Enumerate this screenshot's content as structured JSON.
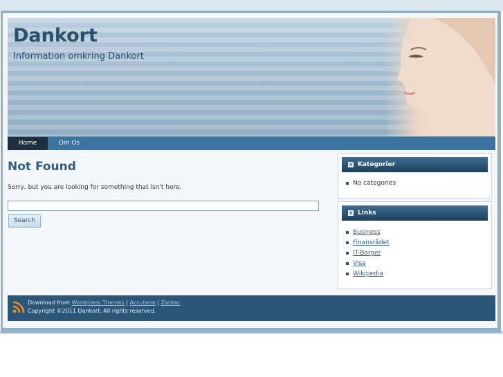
{
  "header": {
    "title": "Dankort",
    "description": "Information omkring Dankort"
  },
  "nav": {
    "items": [
      {
        "label": "Home",
        "active": true
      },
      {
        "label": "Om Os",
        "active": false
      }
    ]
  },
  "main": {
    "title": "Not Found",
    "message": "Sorry, but you are looking for something that isn't here.",
    "search": {
      "value": "",
      "button_label": "Search"
    }
  },
  "sidebar": {
    "categories": {
      "title": "Kategorier",
      "items": [
        "No categories"
      ]
    },
    "links": {
      "title": "Links",
      "items": [
        "Business",
        "Finansrådet",
        "IT-Borger",
        "Visa",
        "Wikipedia"
      ]
    }
  },
  "footer": {
    "prefix": "Download from",
    "link1": "Wordpress Themes",
    "sep1": "|",
    "link2": "Accutane",
    "sep2": "|",
    "link3": "Zantac",
    "copyright": "Copyright ©2011 Dankort. All rights reserved."
  },
  "colors": {
    "accent": "#2c5677",
    "nav": "#3d73a0",
    "nav_active": "#1d2f3f",
    "title": "#2f5f86"
  },
  "icons": [
    "rss-icon",
    "widget-toggle-icon"
  ]
}
